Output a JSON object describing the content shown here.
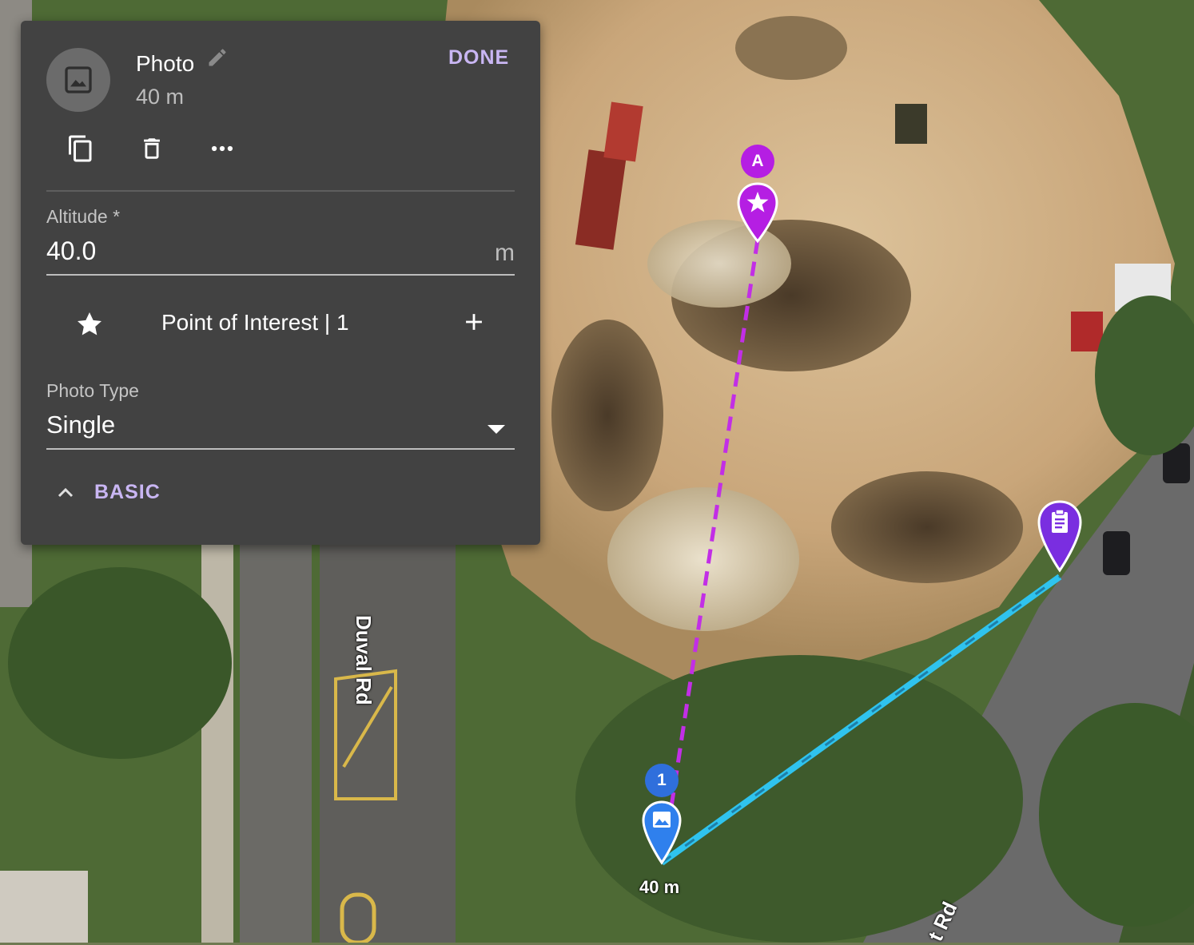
{
  "panel": {
    "title": "Photo",
    "subtitle": "40 m",
    "done_label": "DONE",
    "altitude": {
      "label": "Altitude *",
      "value": "40.0",
      "unit": "m"
    },
    "poi": {
      "label": "Point of Interest | 1"
    },
    "photo_type": {
      "label": "Photo Type",
      "value": "Single"
    },
    "section_label": "BASIC"
  },
  "map": {
    "road_labels": [
      "Duval Rd",
      "t Rd"
    ],
    "poi_marker_label": "A",
    "waypoint_marker_label": "1",
    "waypoint_distance": "40 m",
    "colors": {
      "poi": "#b51ee3",
      "waypoint": "#2f6fdc",
      "survey": "#7a2ee0",
      "path": "#2fc3ee"
    }
  }
}
